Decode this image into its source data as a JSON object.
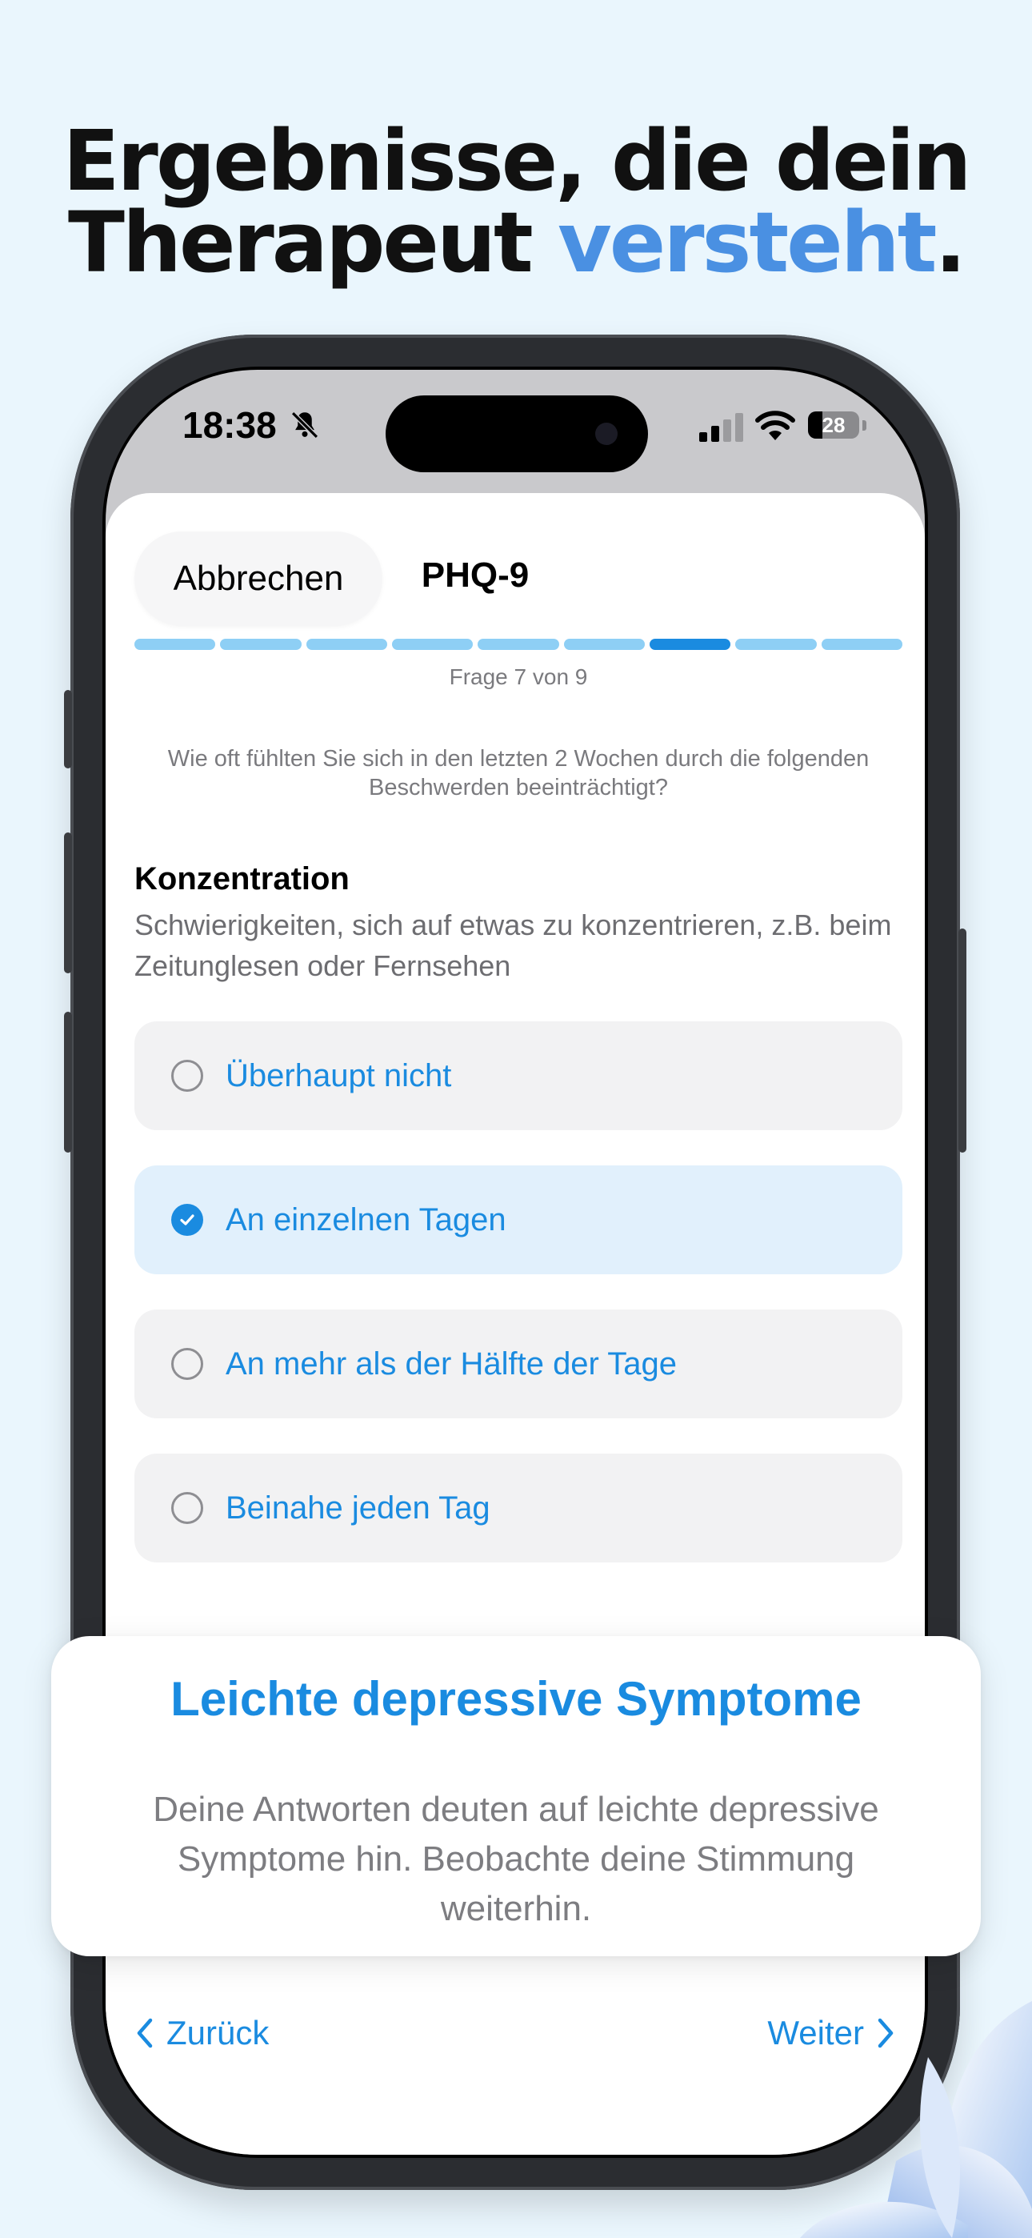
{
  "headline": {
    "line1": "Ergebnisse, die dein",
    "line2_plain": "Therapeut ",
    "line2_accent": "versteht",
    "line2_end": "."
  },
  "statusbar": {
    "time": "18:38",
    "battery": "28"
  },
  "nav": {
    "cancel_label": "Abbrechen",
    "title": "PHQ-9"
  },
  "progress": {
    "total": 9,
    "current": 7,
    "label": "Frage 7 von 9"
  },
  "question": {
    "instruction": "Wie oft fühlten Sie sich in den letzten 2 Wochen durch die folgenden Beschwerden beeinträchtigt?",
    "title": "Konzentration",
    "description": "Schwierigkeiten, sich auf etwas zu konzentrieren, z.B. beim Zeitunglesen oder Fernsehen"
  },
  "options": [
    {
      "label": "Überhaupt nicht",
      "selected": false
    },
    {
      "label": "An einzelnen Tagen",
      "selected": true
    },
    {
      "label": "An mehr als der Hälfte der Tage",
      "selected": false
    },
    {
      "label": "Beinahe jeden Tag",
      "selected": false
    }
  ],
  "result": {
    "title": "Leichte depressive Symptome",
    "text": "Deine Antworten deuten auf leichte depressive Symptome hin. Beobachte deine Stimmung weiterhin."
  },
  "footer": {
    "back_label": "Zurück",
    "next_label": "Weiter"
  },
  "colors": {
    "accent": "#1A8BE0",
    "headline_accent": "#4A90E2",
    "background": "#EAF6FD"
  }
}
